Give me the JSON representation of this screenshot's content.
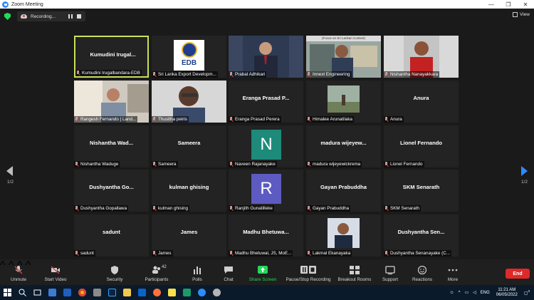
{
  "window": {
    "title": "Zoom Meeting",
    "controls": [
      "—",
      "❐",
      "✕"
    ]
  },
  "topbar": {
    "recording_label": "Recording...",
    "view_label": "View"
  },
  "pages": {
    "left": "1/2",
    "right": "1/2"
  },
  "tiles": [
    {
      "big": "Kumudini  Irugal...",
      "name": "Kumudini Irugalbandara-EDB",
      "type": "text"
    },
    {
      "big": "",
      "name": "Sri Lanka Export Developm...",
      "type": "edb",
      "logo": "EDB"
    },
    {
      "big": "",
      "name": "Prabal Adhikari",
      "type": "video"
    },
    {
      "big": "",
      "name": "Innext Engineering",
      "type": "video",
      "overlay": "(Focus on Sri Lankan Context)"
    },
    {
      "big": "",
      "name": "Nishantha Nanayakkara",
      "type": "video"
    },
    {
      "big": "",
      "name": "Rangesh Fernando | Land...",
      "type": "video"
    },
    {
      "big": "",
      "name": "Thusitha peiris",
      "type": "video"
    },
    {
      "big": "Eranga  Prasad  P...",
      "name": "Eranga Prasad Perera",
      "type": "text"
    },
    {
      "big": "",
      "name": "Himalee Arunatilaka",
      "type": "photo"
    },
    {
      "big": "Anura",
      "name": "Anura",
      "type": "text"
    },
    {
      "big": "Nishantha  Wad...",
      "name": "Nishantha Waduge",
      "type": "text"
    },
    {
      "big": "Sameera",
      "name": "Sameera",
      "type": "text"
    },
    {
      "big": "",
      "name": "Naveen Rajanayake",
      "type": "letter",
      "letter": "N",
      "color": "#1d8a7a"
    },
    {
      "big": "madura  wijeyew...",
      "name": "madura wijeyewickrema",
      "type": "text"
    },
    {
      "big": "Lionel Fernando",
      "name": "Lionel Fernando",
      "type": "text"
    },
    {
      "big": "Dushyantha  Go...",
      "name": "Dushyantha Gopallawa",
      "type": "text"
    },
    {
      "big": "kulman ghising",
      "name": "kulman ghising",
      "type": "text"
    },
    {
      "big": "",
      "name": "Ranjith Gunatilleke",
      "type": "letter",
      "letter": "R",
      "color": "#5d5bc2"
    },
    {
      "big": "Gayan Prabuddha",
      "name": "Gayan Prabuddha",
      "type": "text"
    },
    {
      "big": "SKM Senarath",
      "name": "SKM Senarath",
      "type": "text"
    },
    {
      "big": "sadunt",
      "name": "sadunt",
      "type": "text"
    },
    {
      "big": "James",
      "name": "James",
      "type": "text"
    },
    {
      "big": "Madhu  Bhetuwa...",
      "name": "Madhu Bhetuwal, JS, MoE...",
      "type": "text"
    },
    {
      "big": "",
      "name": "Lakmal Ekanayaka",
      "type": "photo2"
    },
    {
      "big": "Dushyantha  Sen...",
      "name": "Dushyantha Senanayake (C...",
      "type": "text"
    }
  ],
  "toolbar": {
    "unmute": "Unmute",
    "start_video": "Start Video",
    "security": "Security",
    "participants": "Participants",
    "participants_count": "42",
    "polls": "Polls",
    "chat": "Chat",
    "share_screen": "Share Screen",
    "pause_recording": "Pause/Stop Recording",
    "breakout": "Breakout Rooms",
    "support": "Support",
    "reactions": "Reactions",
    "more": "More",
    "end": "End"
  },
  "taskbar": {
    "lang": "ENG",
    "time": "11:21 AM",
    "date": "06/05/2022",
    "notification_count": "3"
  },
  "colors": {
    "accent": "#2d8cff",
    "active_border": "#c8e05a",
    "share": "#23d959",
    "end": "#e02828"
  }
}
